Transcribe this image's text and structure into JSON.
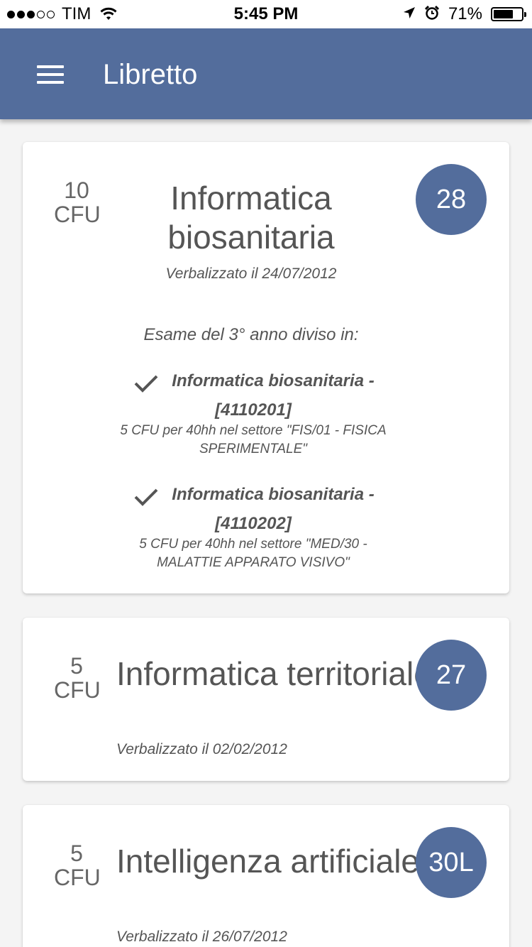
{
  "status_bar": {
    "carrier": "TIM",
    "signal_bars": 3,
    "signal_total": 5,
    "time": "5:45 PM",
    "battery_percent": "71%",
    "battery_level": 0.71,
    "icons": [
      "wifi-icon",
      "location-arrow-icon",
      "alarm-clock-icon",
      "battery-icon"
    ]
  },
  "appbar": {
    "title": "Libretto",
    "menu_icon": "hamburger-menu-icon",
    "color": "#536d9c"
  },
  "exams": [
    {
      "cfu_value": "10",
      "cfu_unit": "CFU",
      "title": "Informatica biosanitaria",
      "grade": "28",
      "date": "Verbalizzato il 24/07/2012",
      "subtitle": "Esame del 3° anno diviso in:",
      "modules": [
        {
          "name": "Informatica biosanitaria -",
          "code": "[4110201]",
          "description": "5 CFU per 40hh nel settore \"FIS/01 - FISICA SPERIMENTALE\"",
          "icon": "checkmark-icon"
        },
        {
          "name": "Informatica biosanitaria -",
          "code": "[4110202]",
          "description": "5 CFU per 40hh nel settore \"MED/30 - MALATTIE APPARATO VISIVO\"",
          "icon": "checkmark-icon"
        }
      ]
    },
    {
      "cfu_value": "5",
      "cfu_unit": "CFU",
      "title": "Informatica territoriale",
      "grade": "27",
      "date": "Verbalizzato il 02/02/2012"
    },
    {
      "cfu_value": "5",
      "cfu_unit": "CFU",
      "title": "Intelligenza artificiale",
      "grade": "30L",
      "date": "Verbalizzato il 26/07/2012"
    }
  ]
}
